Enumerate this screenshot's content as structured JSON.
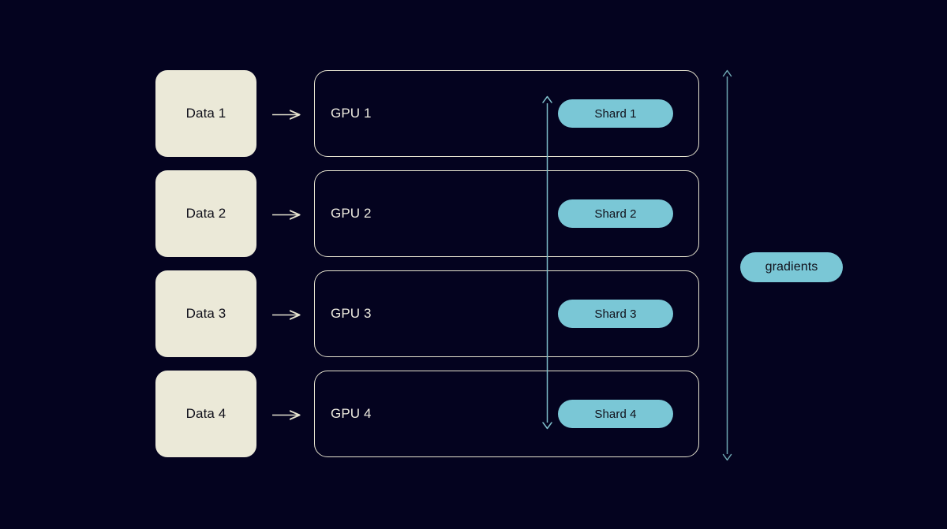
{
  "diagram": {
    "title": "FSDP sharded data parallel diagram",
    "background_color": "#04031f",
    "cream_color": "#ebe9d8",
    "teal_color": "#7ac7d6"
  },
  "rows": [
    {
      "data_label": "Data 1",
      "gpu_label": "GPU 1",
      "shard_label": "Shard 1"
    },
    {
      "data_label": "Data 2",
      "gpu_label": "GPU 2",
      "shard_label": "Shard 2"
    },
    {
      "data_label": "Data 3",
      "gpu_label": "GPU 3",
      "shard_label": "Shard 3"
    },
    {
      "data_label": "Data 4",
      "gpu_label": "GPU 4",
      "shard_label": "Shard 4"
    }
  ],
  "gradients": {
    "label": "gradients"
  },
  "arrows": {
    "feed_arrow_name": "data-to-gpu-arrow",
    "shard_sync_arrow_name": "shard-allgather-double-arrow",
    "gradient_arrow_name": "gradient-reduce-double-arrow"
  }
}
